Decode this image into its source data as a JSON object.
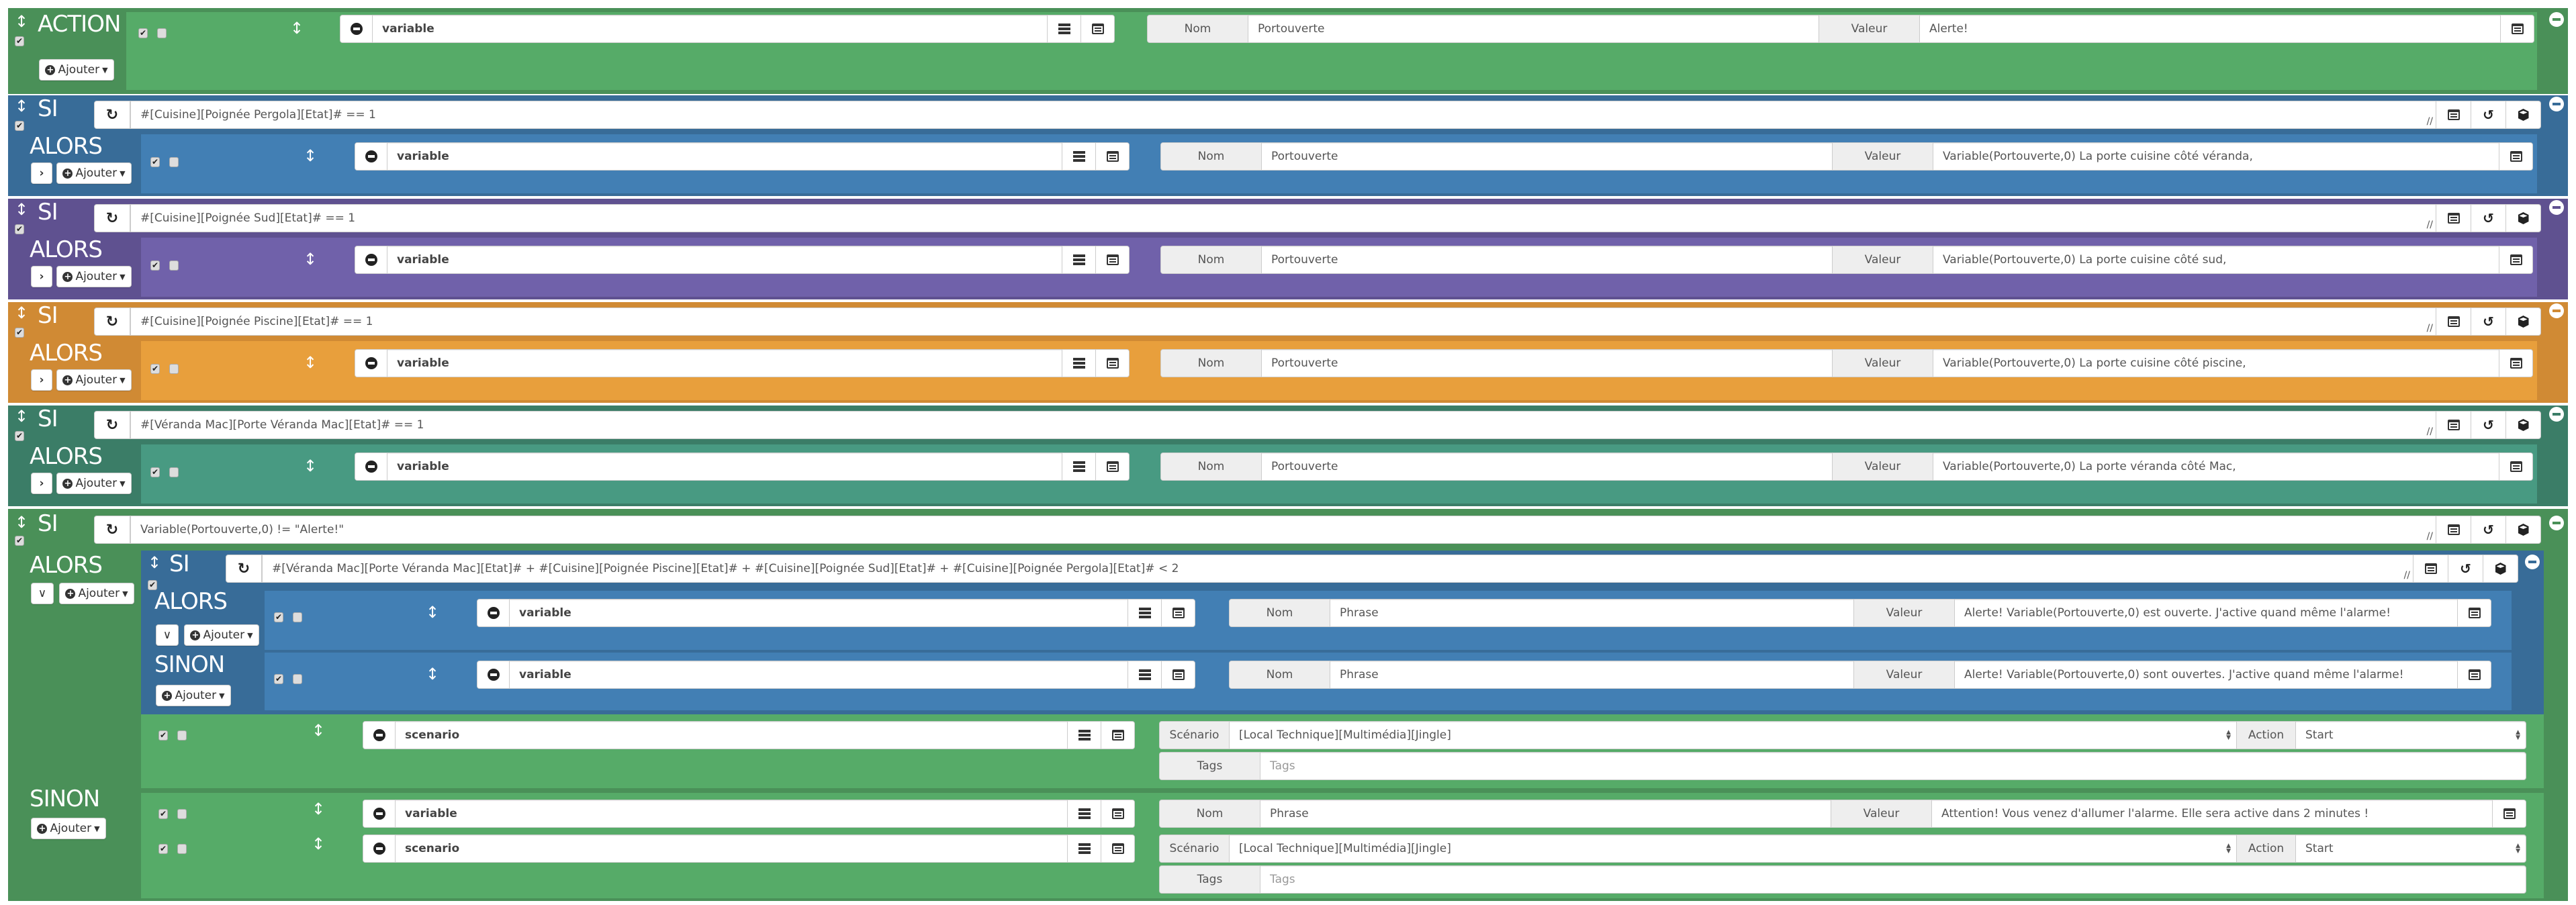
{
  "colors": {
    "action_dark": "#4a9058",
    "action_light": "#56ab68",
    "si1_dark": "#386c98",
    "si1_light": "#427fb4",
    "si2_dark": "#5f5190",
    "si2_light": "#7061aa",
    "si3_dark": "#d08a34",
    "si3_light": "#e89f3c",
    "si4_dark": "#3b7d67",
    "si4_light": "#489a82",
    "si5_dark": "#4a9058",
    "si5_light": "#56ab68"
  },
  "labels": {
    "action": "ACTION",
    "si": "SI",
    "alors": "ALORS",
    "sinon": "SINON",
    "ajouter": "Ajouter",
    "nom": "Nom",
    "valeur": "Valeur",
    "scenario": "Scénario",
    "action_field": "Action",
    "tags": "Tags",
    "tags_placeholder": "Tags"
  },
  "action_block": {
    "cmd": "variable",
    "nom": "Portouverte",
    "valeur": "Alerte!"
  },
  "si_blocks": [
    {
      "condition": "#[Cuisine][Poignée Pergola][Etat]# == 1",
      "cmd": "variable",
      "nom": "Portouverte",
      "valeur": "Variable(Portouverte,0) La porte cuisine côté véranda,"
    },
    {
      "condition": "#[Cuisine][Poignée Sud][Etat]# == 1",
      "cmd": "variable",
      "nom": "Portouverte",
      "valeur": "Variable(Portouverte,0) La porte cuisine côté sud,"
    },
    {
      "condition": "#[Cuisine][Poignée Piscine][Etat]# == 1",
      "cmd": "variable",
      "nom": "Portouverte",
      "valeur": "Variable(Portouverte,0) La porte cuisine côté piscine,"
    },
    {
      "condition": "#[Véranda Mac][Porte Véranda Mac][Etat]# == 1",
      "cmd": "variable",
      "nom": "Portouverte",
      "valeur": "Variable(Portouverte,0) La porte véranda côté Mac,"
    }
  ],
  "main_si": {
    "condition": "Variable(Portouverte,0) != \"Alerte!\"",
    "nested_si": {
      "condition": "#[Véranda Mac][Porte Véranda Mac][Etat]# + #[Cuisine][Poignée Piscine][Etat]# + #[Cuisine][Poignée Sud][Etat]# + #[Cuisine][Poignée Pergola][Etat]# < 2",
      "alors": {
        "cmd": "variable",
        "nom": "Phrase",
        "valeur": "Alerte!  Variable(Portouverte,0) est ouverte.  J'active quand même l'alarme!"
      },
      "sinon": {
        "cmd": "variable",
        "nom": "Phrase",
        "valeur": "Alerte!  Variable(Portouverte,0) sont ouvertes.  J'active quand même l'alarme!"
      }
    },
    "alors_scenario": {
      "cmd": "scenario",
      "scenario": "[Local Technique][Multimédia][Jingle]",
      "action": "Start"
    },
    "sinon_variable": {
      "cmd": "variable",
      "nom": "Phrase",
      "valeur": "Attention! Vous venez d'allumer l'alarme. Elle sera active dans 2 minutes !"
    },
    "sinon_scenario": {
      "cmd": "scenario",
      "scenario": "[Local Technique][Multimédia][Jingle]",
      "action": "Start"
    }
  }
}
